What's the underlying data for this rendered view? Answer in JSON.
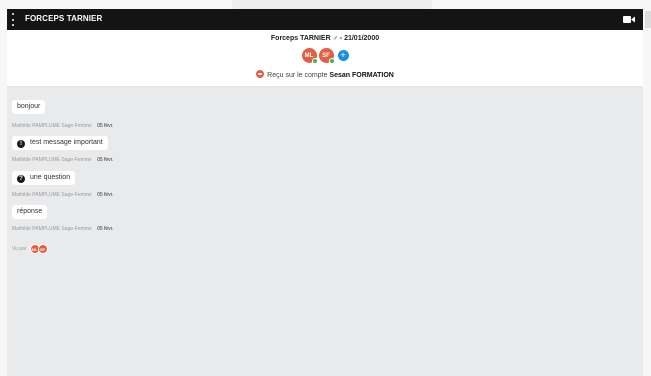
{
  "topbar": {
    "title": "FORCEPS TARNIER"
  },
  "header": {
    "patient": "Forceps TARNIER ♂ - 21/01/2000",
    "participants": [
      {
        "initials": "ML",
        "online": true
      },
      {
        "initials": "SF",
        "online": true
      }
    ],
    "add_label": "+",
    "received_text": "Reçu sur le compte ",
    "received_account": "Sesan FORMATION"
  },
  "messages": [
    {
      "text": "bonjour",
      "icon": "",
      "author": "Mathilde PAMPLUME",
      "role": "Sage-Femme",
      "date": "05 févr."
    },
    {
      "text": "test message important",
      "icon": "!",
      "author": "Mathilde PAMPLUME",
      "role": "Sage-Femme",
      "date": "05 févr."
    },
    {
      "text": "une question",
      "icon": "?",
      "author": "Mathilde PAMPLUME",
      "role": "Sage-Femme",
      "date": "05 févr."
    },
    {
      "text": "réponse",
      "icon": "",
      "author": "Mathilde PAMPLUME",
      "role": "Sage-Femme",
      "date": "05 févr."
    }
  ],
  "seen": {
    "label": "Vu par",
    "avatars": [
      "ML",
      "SF"
    ]
  },
  "colors": {
    "avatar": "#e35e44",
    "online": "#3db84a",
    "add": "#1a8fe0",
    "topbar": "#141414",
    "chat_bg": "#e9eaec"
  }
}
